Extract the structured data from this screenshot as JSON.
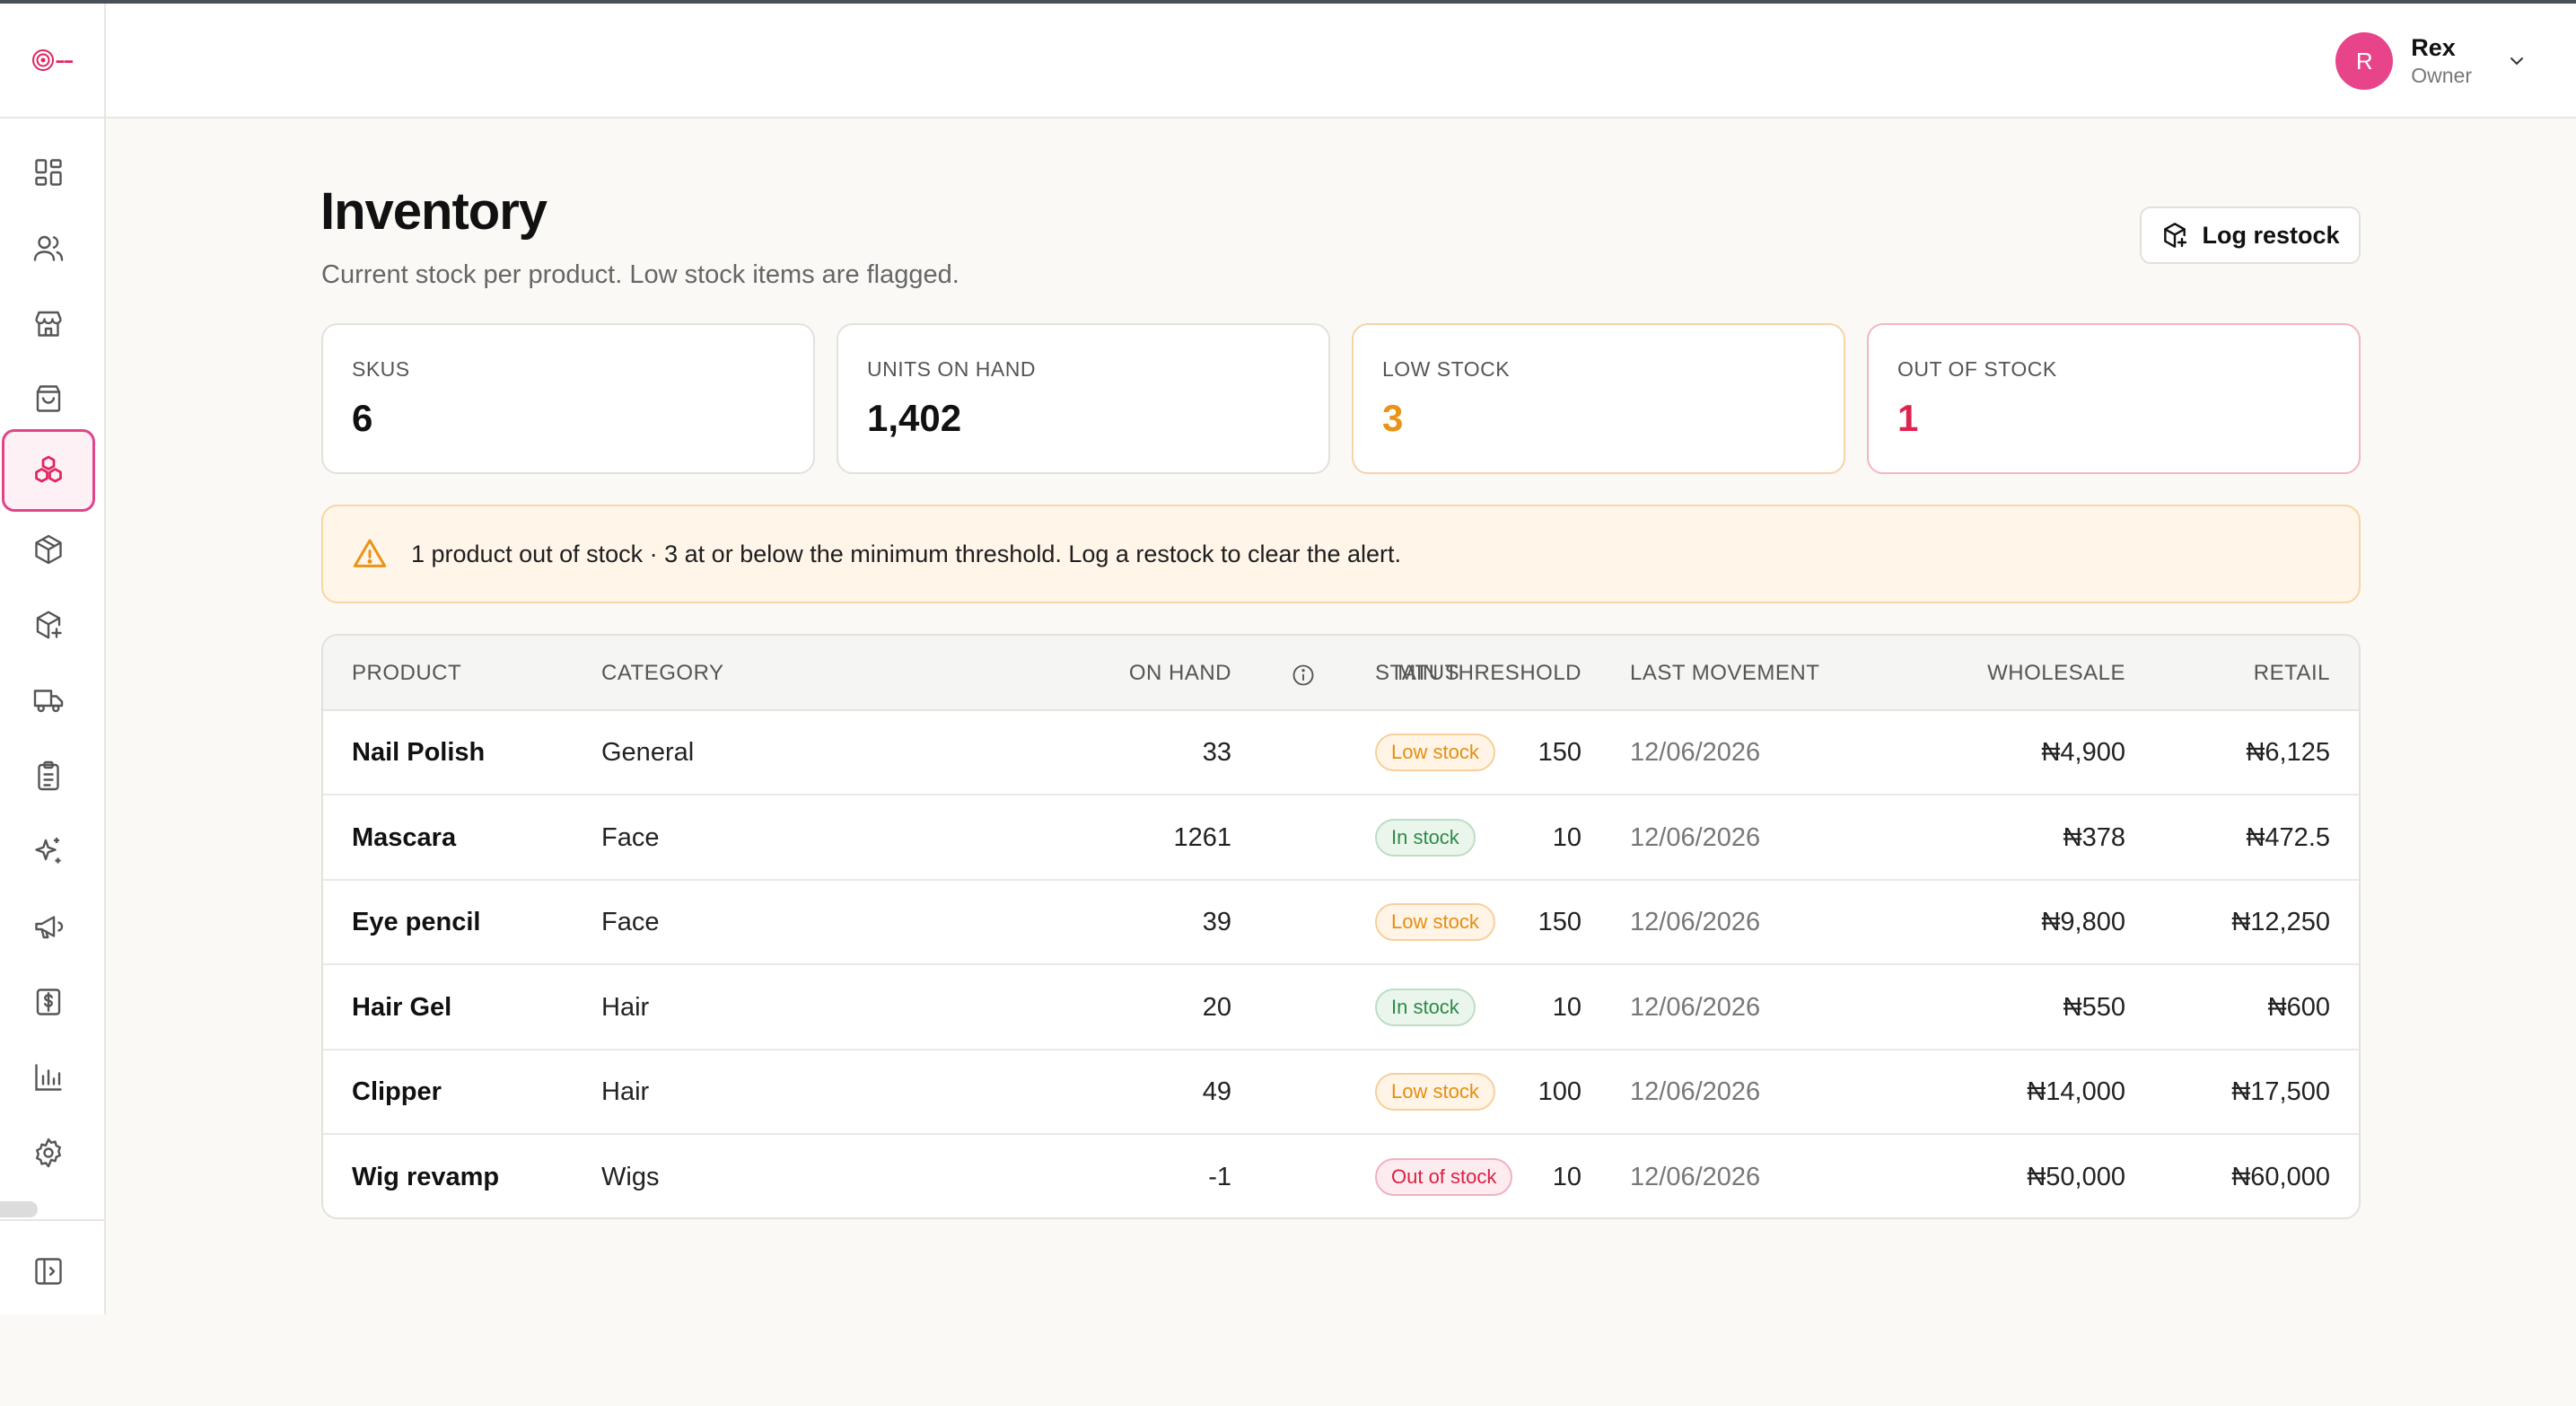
{
  "brand": {
    "accent": "#e0458a",
    "warning": "#e99317",
    "danger": "#e0234f",
    "success": "#2c8a47"
  },
  "header": {
    "user": {
      "initial": "R",
      "name": "Rex",
      "role": "Owner"
    }
  },
  "sidebar": {
    "items": [
      {
        "icon": "dashboard-icon"
      },
      {
        "icon": "users-icon"
      },
      {
        "icon": "store-icon"
      },
      {
        "icon": "shopping-bag-icon"
      },
      {
        "icon": "inventory-icon",
        "active": true
      },
      {
        "icon": "package-icon"
      },
      {
        "icon": "package-plus-icon"
      },
      {
        "icon": "truck-icon"
      },
      {
        "icon": "clipboard-icon"
      },
      {
        "icon": "sparkles-icon"
      },
      {
        "icon": "megaphone-icon"
      },
      {
        "icon": "dollar-icon"
      },
      {
        "icon": "bar-chart-icon"
      },
      {
        "icon": "settings-icon"
      }
    ],
    "collapse_icon": "sidebar-toggle-icon"
  },
  "page": {
    "title": "Inventory",
    "subtitle": "Current stock per product. Low stock items are flagged.",
    "restock_button": "Log restock"
  },
  "stats": [
    {
      "label": "SKUS",
      "value": "6"
    },
    {
      "label": "UNITS ON HAND",
      "value": "1,402"
    },
    {
      "label": "LOW STOCK",
      "value": "3"
    },
    {
      "label": "OUT OF STOCK",
      "value": "1"
    }
  ],
  "alert": {
    "text": "1 product out of stock · 3 at or below the minimum threshold. Log a restock to clear the alert."
  },
  "table": {
    "columns": [
      "PRODUCT",
      "CATEGORY",
      "ON HAND",
      "MIN THRESHOLD",
      "STATUS",
      "LAST MOVEMENT",
      "WHOLESALE",
      "RETAIL"
    ],
    "rows": [
      {
        "product": "Nail Polish",
        "category": "General",
        "on_hand": "33",
        "min": "150",
        "status": "Low stock",
        "status_type": "low",
        "last": "12/06/2026",
        "wholesale": "₦4,900",
        "retail": "₦6,125"
      },
      {
        "product": "Mascara",
        "category": "Face",
        "on_hand": "1261",
        "min": "10",
        "status": "In stock",
        "status_type": "in",
        "last": "12/06/2026",
        "wholesale": "₦378",
        "retail": "₦472.5"
      },
      {
        "product": "Eye pencil",
        "category": "Face",
        "on_hand": "39",
        "min": "150",
        "status": "Low stock",
        "status_type": "low",
        "last": "12/06/2026",
        "wholesale": "₦9,800",
        "retail": "₦12,250"
      },
      {
        "product": "Hair Gel",
        "category": "Hair",
        "on_hand": "20",
        "min": "10",
        "status": "In stock",
        "status_type": "in",
        "last": "12/06/2026",
        "wholesale": "₦550",
        "retail": "₦600"
      },
      {
        "product": "Clipper",
        "category": "Hair",
        "on_hand": "49",
        "min": "100",
        "status": "Low stock",
        "status_type": "low",
        "last": "12/06/2026",
        "wholesale": "₦14,000",
        "retail": "₦17,500"
      },
      {
        "product": "Wig revamp",
        "category": "Wigs",
        "on_hand": "-1",
        "min": "10",
        "status": "Out of stock",
        "status_type": "out",
        "last": "12/06/2026",
        "wholesale": "₦50,000",
        "retail": "₦60,000"
      }
    ]
  }
}
